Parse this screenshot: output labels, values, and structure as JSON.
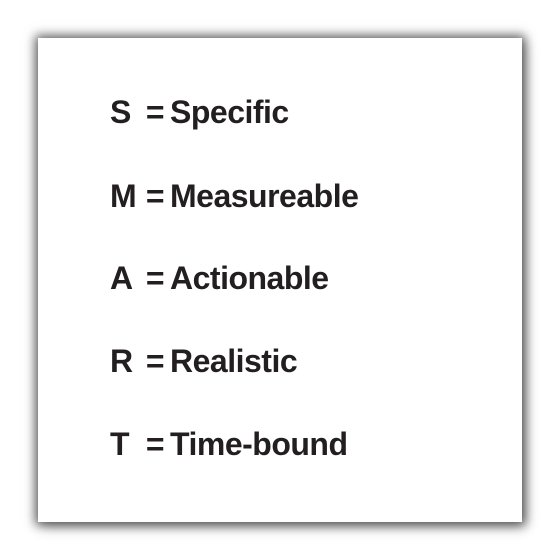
{
  "items": [
    {
      "letter": "S",
      "equals": "=",
      "word": "Specific"
    },
    {
      "letter": "M",
      "equals": "=",
      "word": "Measureable"
    },
    {
      "letter": "A",
      "equals": "=",
      "word": "Actionable"
    },
    {
      "letter": "R",
      "equals": "=",
      "word": "Realistic"
    },
    {
      "letter": "T",
      "equals": "=",
      "word": "Time-bound"
    }
  ]
}
